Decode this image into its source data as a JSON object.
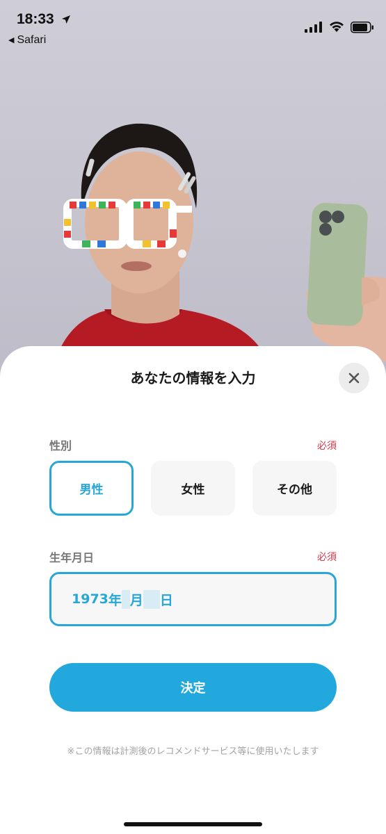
{
  "status_bar": {
    "time": "18:33",
    "back_label": "Safari",
    "icons": [
      "location-arrow-icon",
      "signal-icon",
      "wifi-icon",
      "battery-icon"
    ]
  },
  "sheet": {
    "title": "あなたの情報を入力",
    "close_icon": "close-icon",
    "gender": {
      "label": "性別",
      "required": "必須",
      "options": [
        "男性",
        "女性",
        "その他"
      ],
      "selected": "男性"
    },
    "birthdate": {
      "label": "生年月日",
      "required": "必須",
      "year": "1973",
      "year_unit": "年",
      "month": "",
      "month_unit": "月",
      "day": "",
      "day_unit": "日"
    },
    "submit_label": "決定",
    "note": "※この情報は計測後のレコメンドサービス等に使用いたします"
  },
  "colors": {
    "accent": "#27a7d8",
    "button": "#22a8dc",
    "required": "#d6374a",
    "sweater": "#b41b22"
  }
}
